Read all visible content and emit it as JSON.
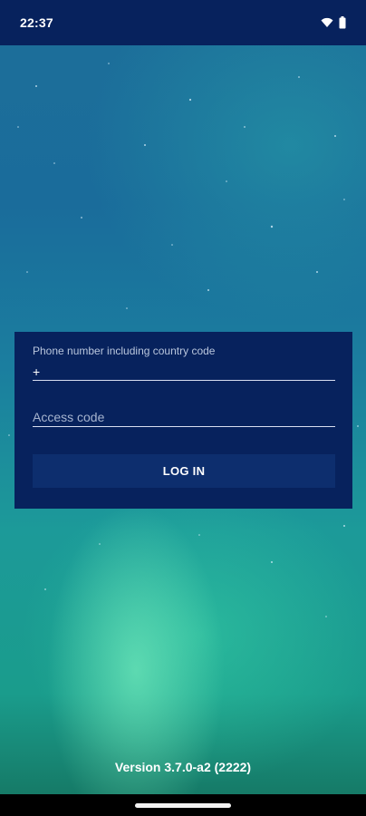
{
  "status_bar": {
    "time": "22:37",
    "icons": [
      "wifi-icon",
      "battery-icon"
    ]
  },
  "login": {
    "phone_label": "Phone number including country code",
    "phone_value": "+",
    "access_code_placeholder": "Access code",
    "access_code_value": "",
    "button_label": "LOG IN"
  },
  "footer": {
    "version": "Version 3.7.0-a2 (2222)"
  },
  "colors": {
    "bar_background": "#07225d",
    "card_background": "#07225d",
    "button_background": "#0d2e6e",
    "text": "#ffffff"
  }
}
